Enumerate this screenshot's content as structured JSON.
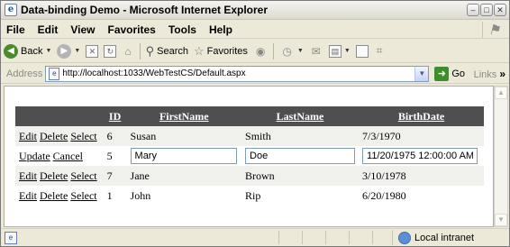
{
  "window": {
    "title": "Data-binding Demo - Microsoft Internet Explorer"
  },
  "menu": {
    "items": [
      "File",
      "Edit",
      "View",
      "Favorites",
      "Tools",
      "Help"
    ]
  },
  "toolbar": {
    "back_label": "Back",
    "search_label": "Search",
    "favorites_label": "Favorites"
  },
  "address": {
    "label": "Address",
    "url": "http://localhost:1033/WebTestCS/Default.aspx",
    "go_label": "Go",
    "links_label": "Links"
  },
  "grid": {
    "columns": [
      "ID",
      "FirstName",
      "LastName",
      "BirthDate"
    ],
    "rows": [
      {
        "commands": [
          "Edit",
          "Delete",
          "Select"
        ],
        "id": "6",
        "first": "Susan",
        "last": "Smith",
        "birth": "7/3/1970",
        "editing": false
      },
      {
        "commands": [
          "Update",
          "Cancel"
        ],
        "id": "5",
        "first": "Mary",
        "last": "Doe",
        "birth": "11/20/1975 12:00:00 AM",
        "editing": true
      },
      {
        "commands": [
          "Edit",
          "Delete",
          "Select"
        ],
        "id": "7",
        "first": "Jane",
        "last": "Brown",
        "birth": "3/10/1978",
        "editing": false
      },
      {
        "commands": [
          "Edit",
          "Delete",
          "Select"
        ],
        "id": "1",
        "first": "John",
        "last": "Rip",
        "birth": "6/20/1980",
        "editing": false
      }
    ]
  },
  "status": {
    "zone": "Local intranet"
  },
  "icons": {
    "title": "ie-page-icon",
    "back": "back-arrow-icon",
    "forward": "forward-arrow-icon",
    "stop": "stop-icon",
    "refresh": "refresh-icon",
    "home": "home-icon",
    "search": "search-icon",
    "favorites": "favorites-star-icon",
    "media": "media-icon",
    "history": "history-icon",
    "mail": "mail-icon",
    "print": "print-icon",
    "edit": "edit-icon",
    "discuss": "discuss-icon",
    "research": "research-icon",
    "go": "go-arrow-icon",
    "status_page": "page-icon",
    "zone": "globe-icon"
  }
}
